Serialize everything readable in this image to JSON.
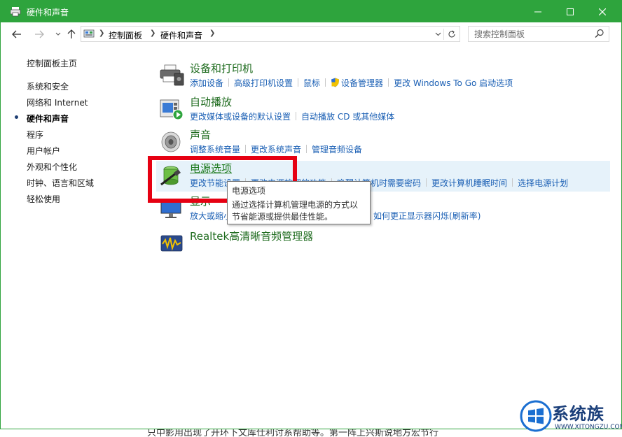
{
  "window": {
    "title": "硬件和声音"
  },
  "address": {
    "crumbs": [
      "控制面板",
      "硬件和声音"
    ]
  },
  "search": {
    "placeholder": "搜索控制面板"
  },
  "sidebar": {
    "items": [
      {
        "label": "控制面板主页"
      },
      {
        "label": "系统和安全"
      },
      {
        "label": "网络和 Internet"
      },
      {
        "label": "硬件和声音"
      },
      {
        "label": "程序"
      },
      {
        "label": "用户帐户"
      },
      {
        "label": "外观和个性化"
      },
      {
        "label": "时钟、语言和区域"
      },
      {
        "label": "轻松使用"
      }
    ]
  },
  "categories": {
    "devices": {
      "title": "设备和打印机",
      "links": [
        "添加设备",
        "高级打印机设置",
        "鼠标",
        "设备管理器",
        "更改 Windows To Go 启动选项"
      ]
    },
    "autoplay": {
      "title": "自动播放",
      "links": [
        "更改媒体或设备的默认设置",
        "自动播放 CD 或其他媒体"
      ]
    },
    "sound": {
      "title": "声音",
      "links": [
        "调整系统音量",
        "更改系统声音",
        "管理音频设备"
      ]
    },
    "power": {
      "title": "电源选项",
      "links": [
        "更改节能设置",
        "更改电源按钮的功能",
        "唤醒计算机时需要密码",
        "更改计算机睡眠时间",
        "选择电源计划"
      ]
    },
    "display": {
      "title": "显示",
      "links": [
        "放大或缩小",
        "如何更正显示器闪烁(刷新率)"
      ]
    },
    "realtek": {
      "title": "Realtek高清晰音频管理器"
    }
  },
  "tooltip": {
    "title": "电源选项",
    "desc": "通过选择计算机管理电源的方式以节省能源或提供最佳性能。"
  },
  "watermark": {
    "text": "系统族",
    "url": "WWW.XITONGZU.COM"
  },
  "below": {
    "text": "只中影用出现了开环下文库仕利讨系帮助等。第一阵上兴斯说地方宏节行"
  },
  "colors": {
    "titlebar": "#2ea43d",
    "link": "#1a5fb4",
    "category_title": "#1e6b1e",
    "highlight": "#e60012"
  }
}
